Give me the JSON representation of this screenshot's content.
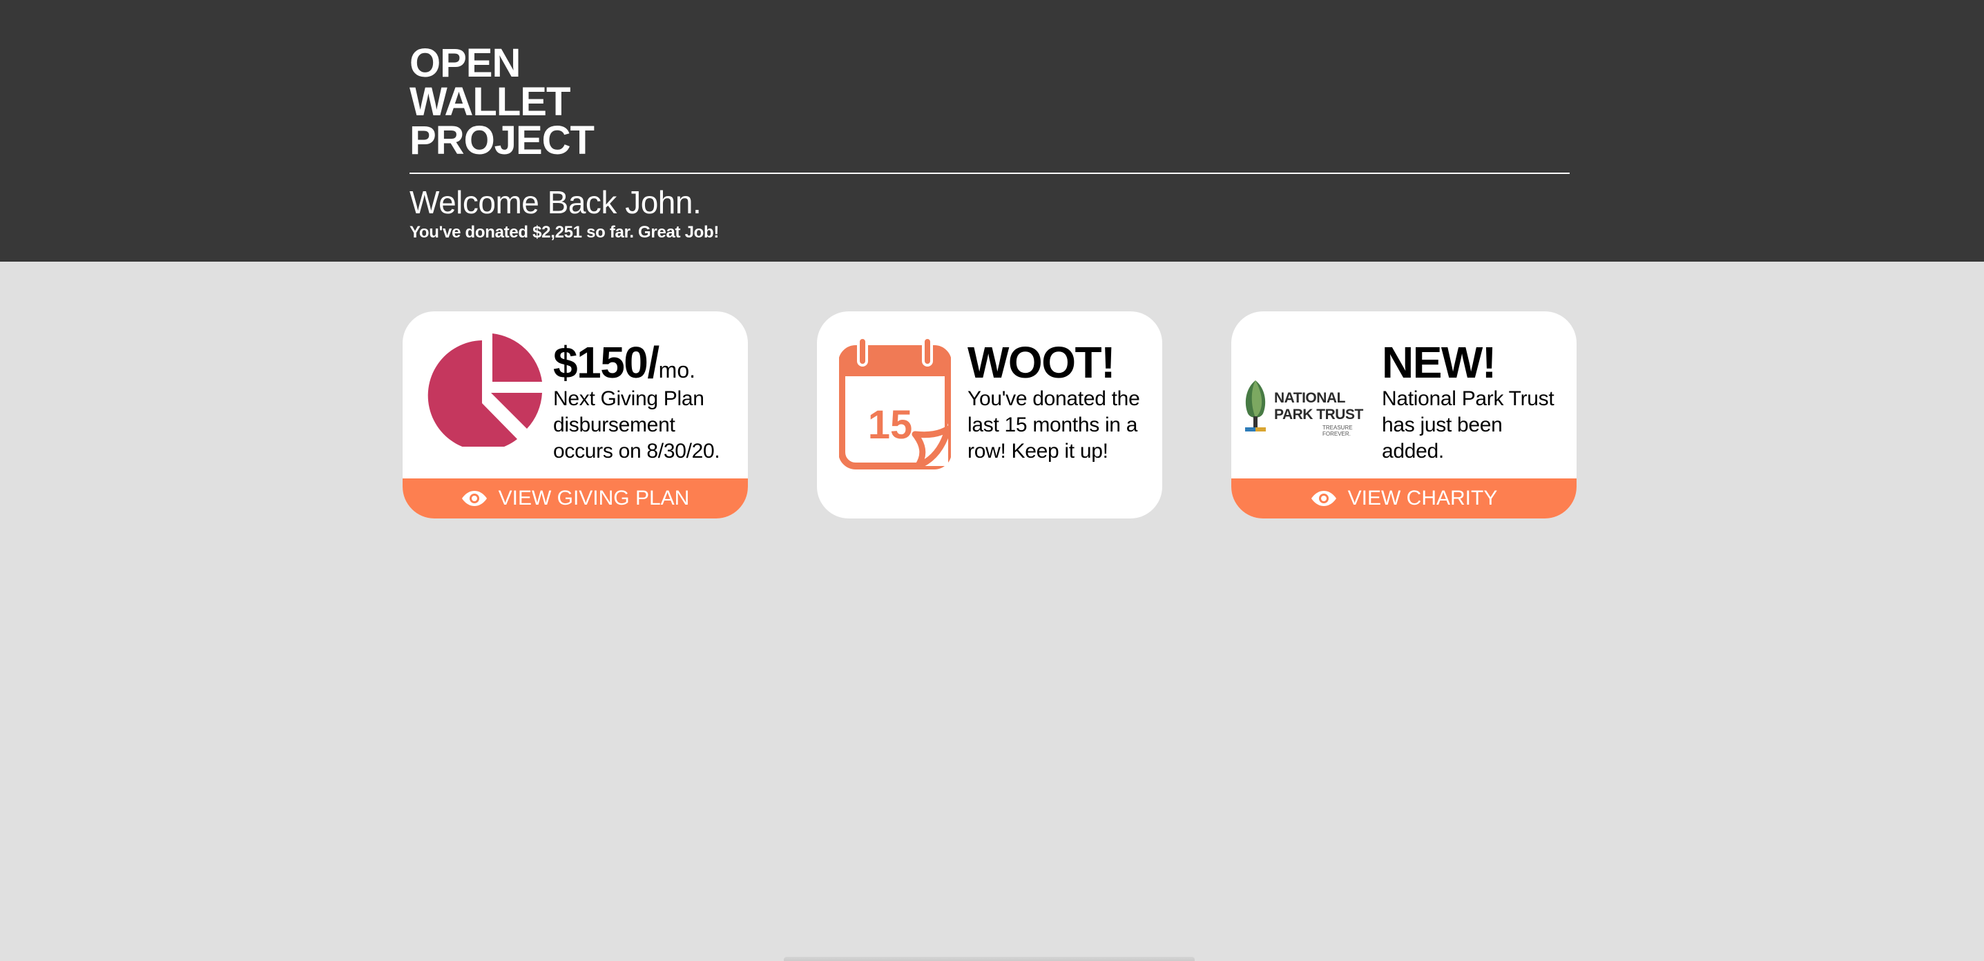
{
  "brand": {
    "line1": "OPEN",
    "line2": "WALLET",
    "line3": "PROJECT"
  },
  "header": {
    "welcome": "Welcome Back John.",
    "donated_text": "You've donated $2,251 so far. Great Job!"
  },
  "cards": [
    {
      "icon": "pie-chart-icon",
      "headline": "$150/",
      "headline_suffix": "mo.",
      "description": "Next Giving Plan disbursement occurs on 8/30/20.",
      "action_label": "VIEW GIVING PLAN",
      "action_icon": "eye-icon"
    },
    {
      "icon": "calendar-icon",
      "calendar_number": "15",
      "headline": "WOOT!",
      "description": "You've donated the last 15 months in a row! Keep it up!"
    },
    {
      "icon": "national-park-trust-logo",
      "logo_text_line1": "NATIONAL",
      "logo_text_line2": "PARK TRUST",
      "logo_tagline": "TREASURE FOREVER.",
      "headline": "NEW!",
      "description": "National Park Trust has just been added.",
      "action_label": "VIEW CHARITY",
      "action_icon": "eye-icon"
    }
  ],
  "colors": {
    "header_bg": "#383838",
    "page_bg": "#e0e0e0",
    "accent": "#fd7f50",
    "pie": "#c5375e",
    "calendar": "#f07a55"
  }
}
